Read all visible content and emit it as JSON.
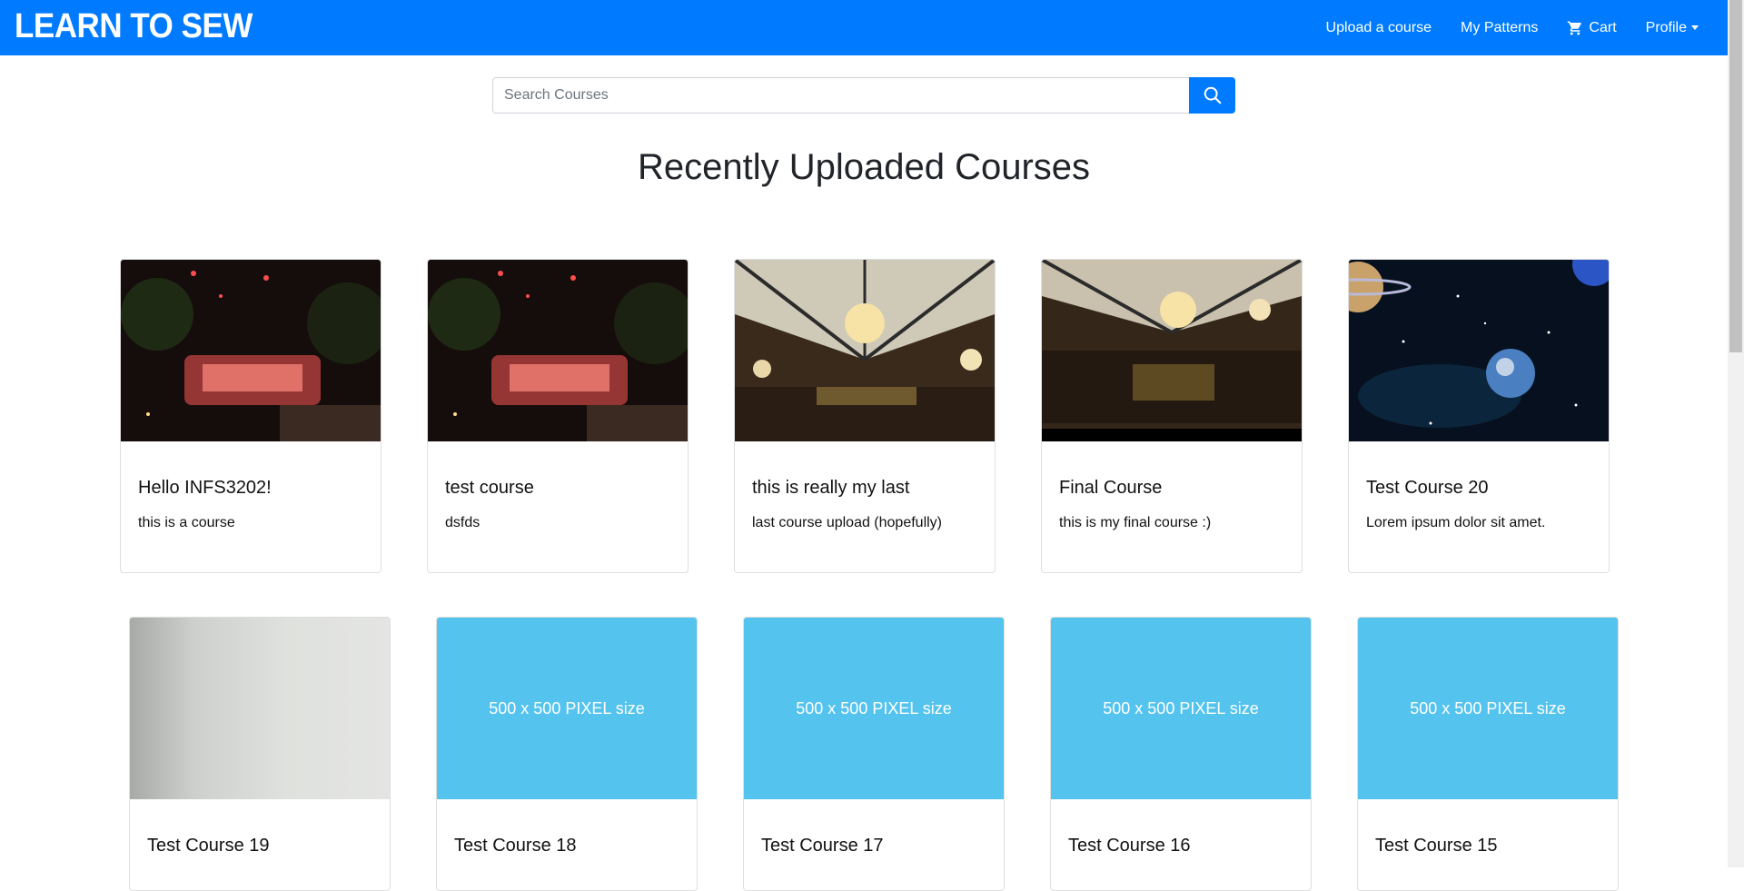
{
  "navbar": {
    "brand": "LEARN TO SEW",
    "links": [
      {
        "label": "Upload a course"
      },
      {
        "label": "My Patterns"
      },
      {
        "label": "Cart",
        "icon": "cart-icon"
      },
      {
        "label": "Profile",
        "icon": "caret-down-icon"
      }
    ]
  },
  "search": {
    "placeholder": "Search Courses",
    "value": "",
    "button_icon": "search-icon"
  },
  "heading": "Recently Uploaded Courses",
  "colors": {
    "primary": "#007bff",
    "placeholder_bg": "#54c3ee"
  },
  "courses": [
    {
      "title": "Hello INFS3202!",
      "description": "this is a course",
      "image": "neon-sign-photo"
    },
    {
      "title": "test course",
      "description": "dsfds",
      "image": "neon-sign-photo"
    },
    {
      "title": "this is really my last",
      "description": "last course upload (hopefully)",
      "image": "chandelier-hall-photo"
    },
    {
      "title": "Final Course",
      "description": "this is my final course :)",
      "image": "chandelier-hall-photo"
    },
    {
      "title": "Test Course 20",
      "description": "Lorem ipsum dolor sit amet.",
      "image": "space-planets-photo"
    },
    {
      "title": "Test Course 19",
      "description": "",
      "image": "grey-blank-photo"
    },
    {
      "title": "Test Course 18",
      "description": "",
      "image": "placeholder",
      "placeholder_text": "500 x 500 PIXEL size"
    },
    {
      "title": "Test Course 17",
      "description": "",
      "image": "placeholder",
      "placeholder_text": "500 x 500 PIXEL size"
    },
    {
      "title": "Test Course 16",
      "description": "",
      "image": "placeholder",
      "placeholder_text": "500 x 500 PIXEL size"
    },
    {
      "title": "Test Course 15",
      "description": "",
      "image": "placeholder",
      "placeholder_text": "500 x 500 PIXEL size"
    }
  ]
}
